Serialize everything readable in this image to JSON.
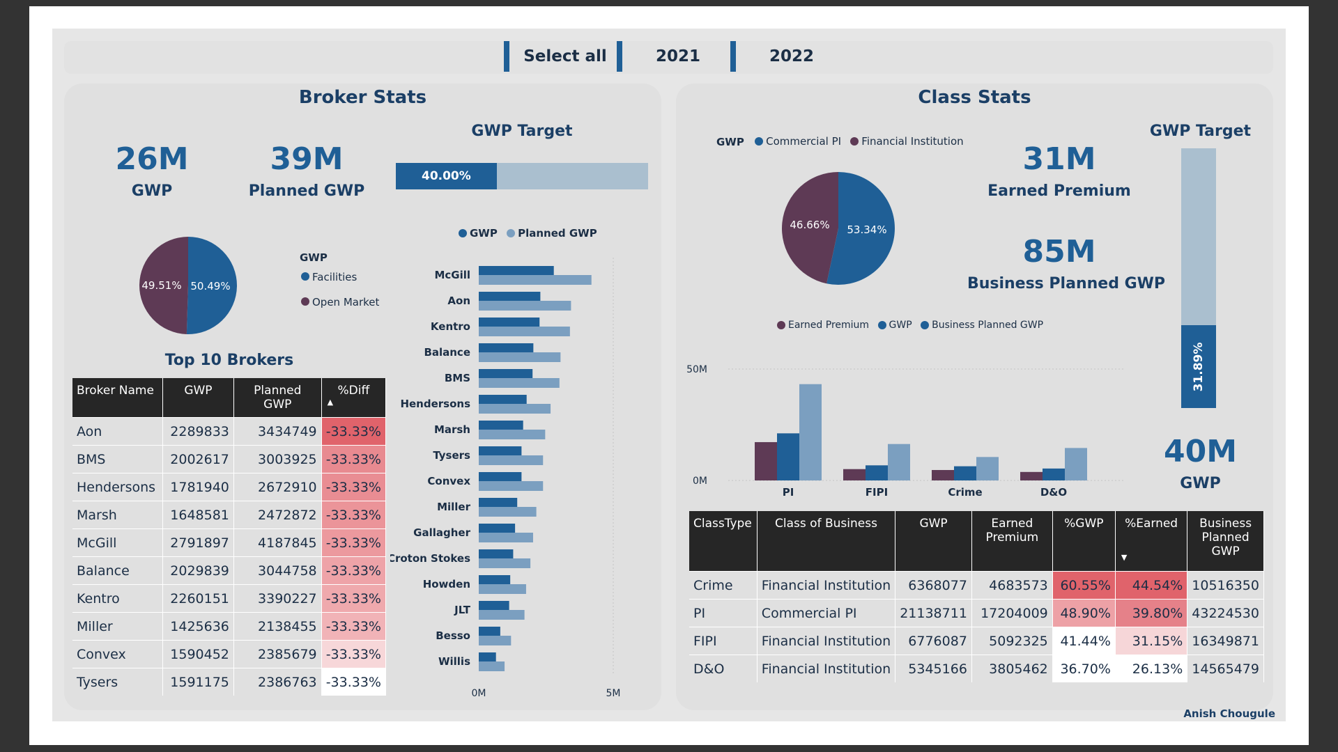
{
  "slicer": {
    "items": [
      "Select all",
      "2021",
      "2022"
    ]
  },
  "broker": {
    "title": "Broker Stats",
    "kpis": [
      {
        "value": "26M",
        "label": "GWP"
      },
      {
        "value": "39M",
        "label": "Planned GWP"
      }
    ],
    "target": {
      "title": "GWP Target",
      "label": "40.00%",
      "fraction": 0.4
    },
    "top10_title": "Top 10 Brokers",
    "table": {
      "headers": [
        "Broker Name",
        "GWP",
        "Planned GWP",
        "%Diff"
      ],
      "rows": [
        [
          "Aon",
          "2289833",
          "3434749",
          "-33.33%"
        ],
        [
          "BMS",
          "2002617",
          "3003925",
          "-33.33%"
        ],
        [
          "Hendersons",
          "1781940",
          "2672910",
          "-33.33%"
        ],
        [
          "Marsh",
          "1648581",
          "2472872",
          "-33.33%"
        ],
        [
          "McGill",
          "2791897",
          "4187845",
          "-33.33%"
        ],
        [
          "Balance",
          "2029839",
          "3044758",
          "-33.33%"
        ],
        [
          "Kentro",
          "2260151",
          "3390227",
          "-33.33%"
        ],
        [
          "Miller",
          "1425636",
          "2138455",
          "-33.33%"
        ],
        [
          "Convex",
          "1590452",
          "2385679",
          "-33.33%"
        ],
        [
          "Tysers",
          "1591175",
          "2386763",
          "-33.33%"
        ]
      ],
      "diff_colors": [
        "#e0636b",
        "#e88a90",
        "#e98d93",
        "#eb9499",
        "#ec999e",
        "#eea3a8",
        "#efa9ad",
        "#f1b3b7",
        "#f7d7d9",
        "#ffffff"
      ]
    }
  },
  "class": {
    "title": "Class Stats",
    "kpis": [
      {
        "value": "31M",
        "label": "Earned Premium"
      },
      {
        "value": "85M",
        "label": "Business Planned GWP"
      },
      {
        "value": "40M",
        "label": "GWP"
      }
    ],
    "target": {
      "title": "GWP Target",
      "label": "31.89%",
      "fraction": 0.3189
    },
    "table": {
      "headers": [
        "ClassType",
        "Class of Business",
        "GWP",
        "Earned Premium",
        "%GWP",
        "%Earned",
        "Business Planned GWP"
      ],
      "rows": [
        [
          "Crime",
          "Financial Institution",
          "6368077",
          "4683573",
          "60.55%",
          "44.54%",
          "10516350"
        ],
        [
          "PI",
          "Commercial PI",
          "21138711",
          "17204009",
          "48.90%",
          "39.80%",
          "43224530"
        ],
        [
          "FIPI",
          "Financial Institution",
          "6776087",
          "5092325",
          "41.44%",
          "31.15%",
          "16349871"
        ],
        [
          "D&O",
          "Financial Institution",
          "5345166",
          "3805462",
          "36.70%",
          "26.13%",
          "14565479"
        ]
      ],
      "gwp_colors": [
        "#e0636b",
        "#eda1a6",
        "#ffffff",
        "#ffffff"
      ],
      "earned_colors": [
        "#e0636b",
        "#e58189",
        "#f6d6d8",
        "#ffffff"
      ]
    }
  },
  "colors": {
    "gwp": "#1f5f96",
    "planned": "#7b9fc0",
    "open_market": "#5e3a55",
    "light_bar": "#aabfcf"
  },
  "icons": {
    "sort_up": "triangle-up-icon",
    "sort_down": "triangle-down-icon"
  },
  "credit": "Anish Chougule",
  "chart_data": [
    {
      "type": "pie",
      "legend_title": "GWP",
      "labels": [
        "Facilities",
        "Open Market"
      ],
      "values": [
        50.49,
        49.51
      ],
      "value_labels": [
        "50.49%",
        "49.51%"
      ],
      "colors": [
        "#1f5f96",
        "#5e3a55"
      ]
    },
    {
      "type": "bar",
      "orientation": "horizontal",
      "categories": [
        "McGill",
        "Aon",
        "Kentro",
        "Balance",
        "BMS",
        "Hendersons",
        "Marsh",
        "Tysers",
        "Convex",
        "Miller",
        "Gallagher",
        "Croton Stokes",
        "Howden",
        "JLT",
        "Besso",
        "Willis"
      ],
      "series": [
        {
          "name": "GWP",
          "values": [
            2.79,
            2.29,
            2.26,
            2.03,
            2.0,
            1.78,
            1.65,
            1.59,
            1.59,
            1.43,
            1.35,
            1.28,
            1.17,
            1.13,
            0.8,
            0.64
          ]
        },
        {
          "name": "Planned GWP",
          "values": [
            4.19,
            3.43,
            3.39,
            3.04,
            3.0,
            2.67,
            2.47,
            2.39,
            2.39,
            2.14,
            2.02,
            1.92,
            1.76,
            1.7,
            1.2,
            0.96
          ]
        }
      ],
      "xlim": [
        0,
        5
      ],
      "xticks": [
        "0M",
        "5M"
      ],
      "colors": [
        "#1f5f96",
        "#7b9fc0"
      ],
      "legend_placement": "top"
    },
    {
      "type": "pie",
      "legend_title": "GWP",
      "labels": [
        "Commercial PI",
        "Financial Institution"
      ],
      "values": [
        53.34,
        46.66
      ],
      "value_labels": [
        "53.34%",
        "46.66%"
      ],
      "colors": [
        "#1f5f96",
        "#5e3a55"
      ]
    },
    {
      "type": "bar",
      "categories": [
        "PI",
        "FIPI",
        "Crime",
        "D&O"
      ],
      "series": [
        {
          "name": "Earned Premium",
          "values": [
            17.2,
            5.09,
            4.68,
            3.81
          ]
        },
        {
          "name": "GWP",
          "values": [
            21.14,
            6.78,
            6.37,
            5.35
          ]
        },
        {
          "name": "Business Planned GWP",
          "values": [
            43.22,
            16.35,
            10.52,
            14.57
          ]
        }
      ],
      "ylim": [
        0,
        50
      ],
      "yticks": [
        "0M",
        "50M"
      ],
      "colors": [
        "#5e3a55",
        "#1f5f96",
        "#7b9fc0"
      ],
      "legend_placement": "top"
    }
  ]
}
